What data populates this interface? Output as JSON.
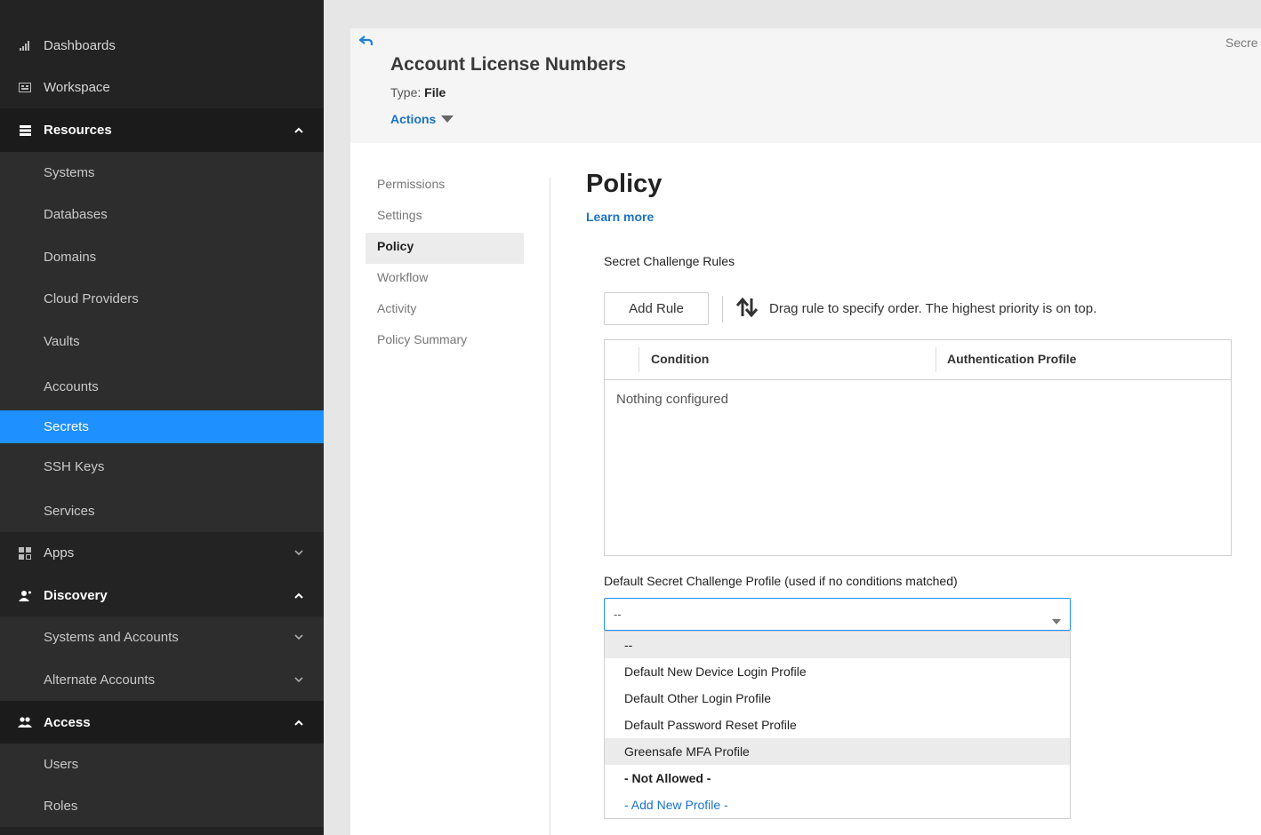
{
  "sidebar": {
    "items": [
      {
        "label": "Dashboards",
        "icon": "bar-chart-icon"
      },
      {
        "label": "Workspace",
        "icon": "workspace-icon"
      },
      {
        "label": "Resources",
        "icon": "list-icon"
      },
      {
        "label": "Systems"
      },
      {
        "label": "Databases"
      },
      {
        "label": "Domains"
      },
      {
        "label": "Cloud Providers"
      },
      {
        "label": "Vaults"
      },
      {
        "label": "Accounts"
      },
      {
        "label": "Secrets"
      },
      {
        "label": "SSH Keys"
      },
      {
        "label": "Services"
      },
      {
        "label": "Apps",
        "icon": "apps-grid-icon"
      },
      {
        "label": "Discovery",
        "icon": "discovery-icon"
      },
      {
        "label": "Systems and Accounts"
      },
      {
        "label": "Alternate Accounts"
      },
      {
        "label": "Access",
        "icon": "users-icon"
      },
      {
        "label": "Users"
      },
      {
        "label": "Roles"
      }
    ],
    "active": "Secrets"
  },
  "header": {
    "top_right": "Secre",
    "title": "Account License Numbers",
    "type_label": "Type:",
    "type_value": "File",
    "actions_label": "Actions"
  },
  "tabs": {
    "items": [
      "Permissions",
      "Settings",
      "Policy",
      "Workflow",
      "Activity",
      "Policy Summary"
    ],
    "selected": "Policy"
  },
  "policy": {
    "heading": "Policy",
    "learn_more": "Learn more",
    "rules_label": "Secret Challenge Rules",
    "add_rule": "Add Rule",
    "drag_hint": "Drag rule to specify order. The highest priority is on top.",
    "columns": [
      "Condition",
      "Authentication Profile"
    ],
    "empty_message": "Nothing configured",
    "default_label": "Default Secret Challenge Profile (used if no conditions matched)",
    "select_value": "--",
    "options": [
      "--",
      "Default New Device Login Profile",
      "Default Other Login Profile",
      "Default Password Reset Profile",
      "Greensafe MFA Profile",
      "- Not Allowed -",
      "- Add New Profile -"
    ]
  },
  "colors": {
    "sidebar_bg": "#232323",
    "active_bg": "#1e90ff",
    "link": "#1a73c9"
  }
}
